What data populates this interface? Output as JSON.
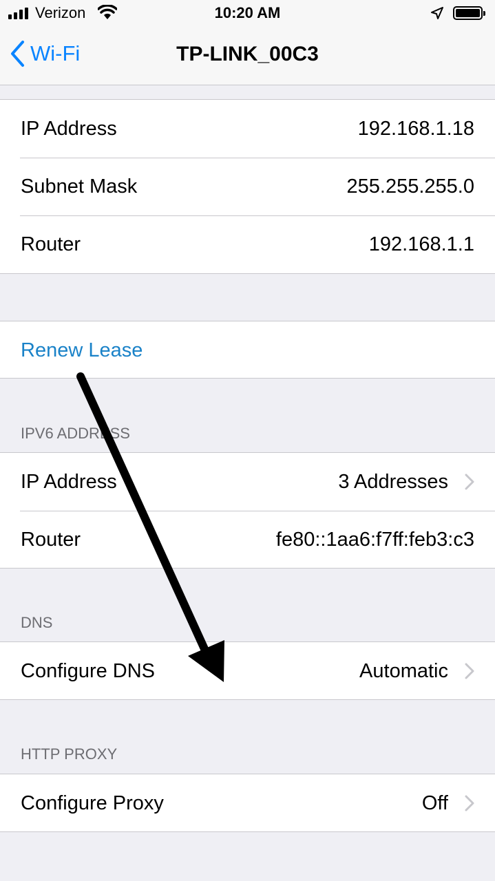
{
  "status_bar": {
    "carrier": "Verizon",
    "time": "10:20 AM",
    "icons": [
      "signal-bars-icon",
      "wifi-icon",
      "location-arrow-icon",
      "battery-icon"
    ]
  },
  "nav": {
    "back_label": "Wi-Fi",
    "title": "TP-LINK_00C3",
    "accent_color": "#0a84ff"
  },
  "ipv4": {
    "rows": [
      {
        "label": "IP Address",
        "value": "192.168.1.18"
      },
      {
        "label": "Subnet Mask",
        "value": "255.255.255.0"
      },
      {
        "label": "Router",
        "value": "192.168.1.1"
      }
    ]
  },
  "renew": {
    "label": "Renew Lease"
  },
  "ipv6": {
    "header": "IPV6 ADDRESS",
    "rows": [
      {
        "label": "IP Address",
        "value": "3 Addresses"
      },
      {
        "label": "Router",
        "value": "fe80::1aa6:f7ff:feb3:c3"
      }
    ]
  },
  "dns": {
    "header": "DNS",
    "configure_label": "Configure DNS",
    "configure_value": "Automatic"
  },
  "proxy": {
    "header": "HTTP PROXY",
    "configure_label": "Configure Proxy",
    "configure_value": "Off"
  }
}
